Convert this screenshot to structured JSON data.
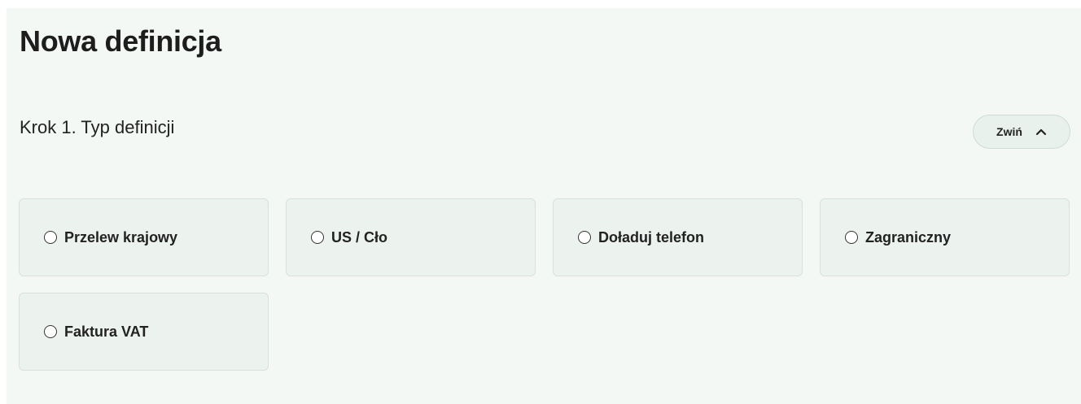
{
  "page": {
    "title": "Nowa definicja"
  },
  "step": {
    "title": "Krok 1. Typ definicji",
    "collapse_label": "Zwiń",
    "collapse_icon": "chevron-up-icon"
  },
  "definition_types": [
    {
      "label": "Przelew krajowy",
      "selected": false
    },
    {
      "label": "US / Cło",
      "selected": false
    },
    {
      "label": "Doładuj telefon",
      "selected": false
    },
    {
      "label": "Zagraniczny",
      "selected": false
    },
    {
      "label": "Faktura VAT",
      "selected": false
    }
  ],
  "colors": {
    "panel_background": "#f3f8f5",
    "card_background": "#ecf2ee",
    "card_border": "#d6e2db",
    "button_background": "#e9f1ec"
  }
}
